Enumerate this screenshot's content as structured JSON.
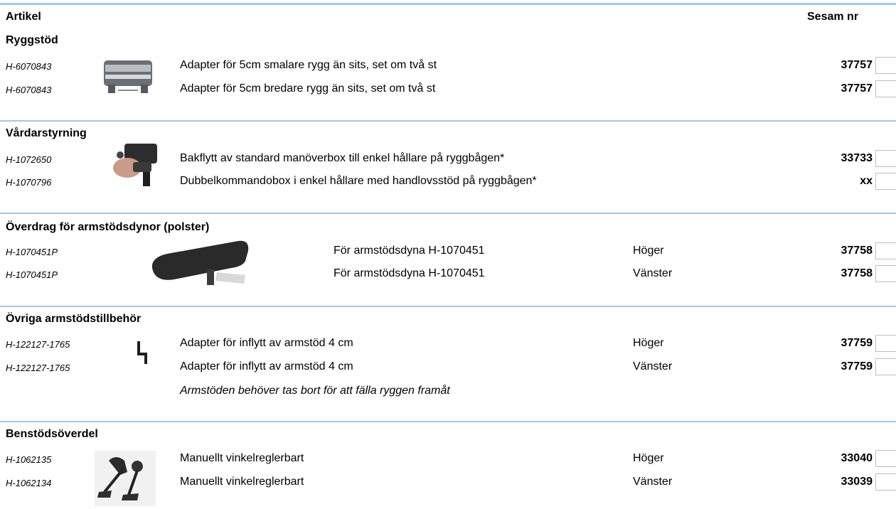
{
  "header": {
    "artikel": "Artikel",
    "sesam": "Sesam nr"
  },
  "sections": [
    {
      "title": "Ryggstöd",
      "image": "backrest-adapter-image",
      "rows": [
        {
          "article": "H-6070843",
          "description": "Adapter för 5cm smalare rygg än sits, set om två st",
          "side": "",
          "sesam": "37757"
        },
        {
          "article": "H-6070843",
          "description": "Adapter för 5cm bredare rygg än sits, set om två st",
          "side": "",
          "sesam": "37757"
        }
      ]
    },
    {
      "title": "Vårdarstyrning",
      "image": "control-box-image",
      "rows": [
        {
          "article": "H-1072650",
          "description": "Bakflytt av standard manöverbox till enkel hållare på ryggbågen*",
          "side": "",
          "sesam": "33733"
        },
        {
          "article": "H-1070796",
          "description": "Dubbelkommandobox i enkel hållare med handlovsstöd på ryggbågen*",
          "side": "",
          "sesam": "xx"
        }
      ]
    },
    {
      "title": "Överdrag för armstödsdynor (polster)",
      "image": "armrest-cushion-image",
      "rows": [
        {
          "article": "H-1070451P",
          "description": "För armstödsdyna H-1070451",
          "side": "Höger",
          "sesam": "37758"
        },
        {
          "article": "H-1070451P",
          "description": "För armstödsdyna H-1070451",
          "side": "Vänster",
          "sesam": "37758"
        }
      ]
    },
    {
      "title": "Övriga armstödstillbehör",
      "image": "armrest-adapter-image",
      "rows": [
        {
          "article": "H-122127-1765",
          "description": "Adapter för inflytt av armstöd 4 cm",
          "side": "Höger",
          "sesam": "37759"
        },
        {
          "article": "H-122127-1765",
          "description": "Adapter för inflytt av armstöd 4 cm",
          "side": "Vänster",
          "sesam": "37759"
        }
      ],
      "note": "Armstöden behöver tas bort för att fälla ryggen framåt"
    },
    {
      "title": "Benstödsöverdel",
      "image": "legrest-image",
      "rows": [
        {
          "article": "H-1062135",
          "description": "Manuellt vinkelreglerbart",
          "side": "Höger",
          "sesam": "33040"
        },
        {
          "article": "H-1062134",
          "description": "Manuellt vinkelreglerbart",
          "side": "Vänster",
          "sesam": "33039"
        }
      ]
    }
  ]
}
